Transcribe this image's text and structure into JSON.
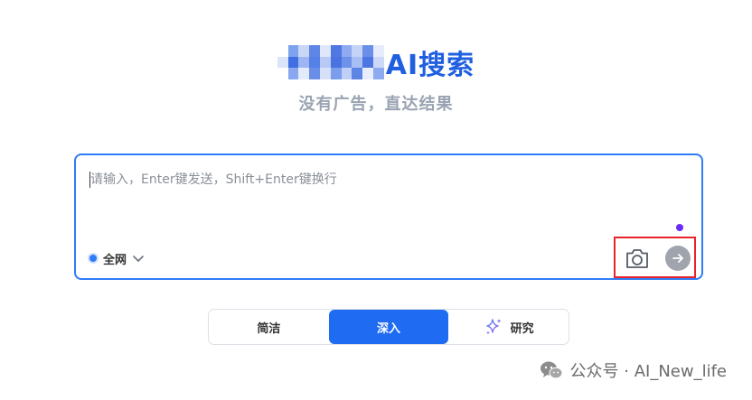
{
  "header": {
    "title": "AI搜索",
    "subtitle": "没有广告，直达结果"
  },
  "search": {
    "placeholder": "请输入，Enter键发送，Shift+Enter键换行",
    "value": "",
    "scope_label": "全网"
  },
  "modes": [
    {
      "label": "简洁",
      "active": false
    },
    {
      "label": "深入",
      "active": true
    },
    {
      "label": "研究",
      "active": false
    }
  ],
  "watermark": {
    "text": "公众号 · AI_New_life"
  },
  "icons": {
    "scope_dropdown": "chevron-down-icon",
    "camera": "camera-icon",
    "send": "arrow-right-icon",
    "research": "sparkle-icon",
    "watermark": "wechat-icon"
  },
  "colors": {
    "brand": "#1f5fe0",
    "accent": "#2f7cf6",
    "active_tab": "#1f6cf2",
    "highlight": "#e8232a",
    "send_button": "#9fa4ad"
  }
}
